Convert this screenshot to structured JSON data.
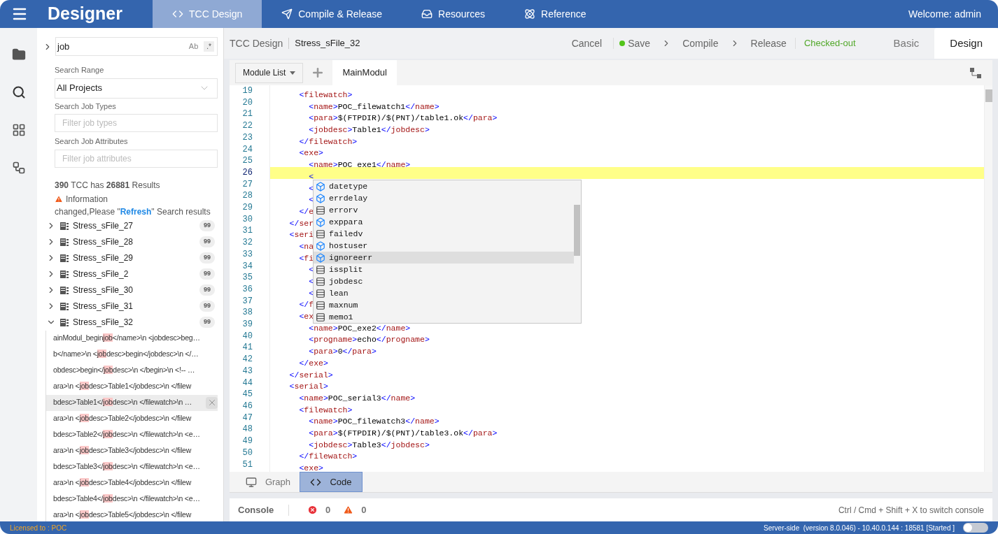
{
  "app": {
    "title": "Designer",
    "welcome": "Welcome: admin"
  },
  "nav_tabs": [
    {
      "label": "TCC Design",
      "selected": true
    },
    {
      "label": "Compile & Release",
      "selected": false
    },
    {
      "label": "Resources",
      "selected": false
    },
    {
      "label": "Reference",
      "selected": false
    }
  ],
  "sidebar": {
    "search": {
      "value": "job",
      "case_toggle": "Ab",
      "regex_toggle": ".*"
    },
    "range": {
      "label": "Search Range",
      "value": "All Projects"
    },
    "job_types": {
      "label": "Search Job Types",
      "placeholder": "Filter job types"
    },
    "job_attributes": {
      "label": "Search Job Attributes",
      "placeholder": "Filter job attributes"
    },
    "summary": "**390** TCC has **26881** Results",
    "notice": {
      "title": "Information",
      "before": "changed,Please \"",
      "link": "Refresh",
      "after": "\" Search results"
    },
    "results": [
      {
        "name": "Stress_sFile_27",
        "count": "99",
        "expanded": false
      },
      {
        "name": "Stress_sFile_28",
        "count": "99",
        "expanded": false
      },
      {
        "name": "Stress_sFile_29",
        "count": "99",
        "expanded": false
      },
      {
        "name": "Stress_sFile_2",
        "count": "99",
        "expanded": false
      },
      {
        "name": "Stress_sFile_30",
        "count": "99",
        "expanded": false
      },
      {
        "name": "Stress_sFile_31",
        "count": "99",
        "expanded": false
      },
      {
        "name": "Stress_sFile_32",
        "count": "99",
        "expanded": true,
        "children": [
          {
            "before": "ainModul_begin",
            "match": "job",
            "after": "</name>\\n <jobdesc>beg…",
            "selected": false
          },
          {
            "before": "b</name>\\n <",
            "match": "job",
            "after": "desc>begin</jobdesc>\\n </…",
            "selected": false
          },
          {
            "before": "obdesc>begin</",
            "match": "job",
            "after": "desc>\\n </begin>\\n <!-- …",
            "selected": false
          },
          {
            "before": "ara>\\n <",
            "match": "job",
            "after": "desc>Table1</jobdesc>\\n </filew",
            "selected": false
          },
          {
            "before": "bdesc>Table1</",
            "match": "job",
            "after": "desc>\\n </filewatch>\\n …",
            "selected": true
          },
          {
            "before": "ara>\\n <",
            "match": "job",
            "after": "desc>Table2</jobdesc>\\n </filew",
            "selected": false
          },
          {
            "before": "bdesc>Table2</",
            "match": "job",
            "after": "desc>\\n </filewatch>\\n <e…",
            "selected": false
          },
          {
            "before": "ara>\\n <",
            "match": "job",
            "after": "desc>Table3</jobdesc>\\n </filew",
            "selected": false
          },
          {
            "before": "bdesc>Table3</",
            "match": "job",
            "after": "desc>\\n </filewatch>\\n <e…",
            "selected": false
          },
          {
            "before": "ara>\\n <",
            "match": "job",
            "after": "desc>Table4</jobdesc>\\n </filew",
            "selected": false
          },
          {
            "before": "bdesc>Table4</",
            "match": "job",
            "after": "desc>\\n </filewatch>\\n <e…",
            "selected": false
          },
          {
            "before": "ara>\\n <",
            "match": "job",
            "after": "desc>Table5</jobdesc>\\n </filew",
            "selected": false
          }
        ]
      }
    ]
  },
  "header": {
    "section": "TCC Design",
    "file": "Stress_sFile_32",
    "cancel": "Cancel",
    "save": "Save",
    "compile": "Compile",
    "release": "Release",
    "status": "Checked-out",
    "view_tabs": [
      {
        "label": "Basic",
        "selected": false
      },
      {
        "label": "Design",
        "selected": true
      }
    ]
  },
  "toolbar": {
    "module_list": "Module List",
    "modules": [
      {
        "label": "MainModul",
        "selected": true
      }
    ]
  },
  "editor": {
    "lines": [
      {
        "number": "19",
        "code": "      <filewatch>",
        "current": false
      },
      {
        "number": "20",
        "code": "        <name>POC_filewatch1</name>",
        "current": false
      },
      {
        "number": "21",
        "code": "        <para>$(FTPDIR)/$(PNT)/table1.ok</para>",
        "current": false
      },
      {
        "number": "22",
        "code": "        <jobdesc>Table1</jobdesc>",
        "current": false
      },
      {
        "number": "23",
        "code": "      </filewatch>",
        "current": false
      },
      {
        "number": "24",
        "code": "      <exe>",
        "current": false
      },
      {
        "number": "25",
        "code": "        <name>POC_exe1</name>",
        "current": false
      },
      {
        "number": "26",
        "code": "        <",
        "current": true
      },
      {
        "number": "27",
        "code": "        <",
        "current": false
      },
      {
        "number": "28",
        "code": "        <",
        "current": false
      },
      {
        "number": "29",
        "code": "      </e",
        "current": false
      },
      {
        "number": "30",
        "code": "    </ser",
        "current": false
      },
      {
        "number": "31",
        "code": "    <seri",
        "current": false
      },
      {
        "number": "32",
        "code": "      <na",
        "current": false
      },
      {
        "number": "33",
        "code": "      <fi",
        "current": false
      },
      {
        "number": "34",
        "code": "        <",
        "current": false
      },
      {
        "number": "35",
        "code": "        <",
        "current": false
      },
      {
        "number": "36",
        "code": "        <",
        "current": false
      },
      {
        "number": "37",
        "code": "      </f",
        "current": false
      },
      {
        "number": "38",
        "code": "      <ex",
        "current": false
      },
      {
        "number": "39",
        "code": "        <name>POC_exe2</name>",
        "current": false
      },
      {
        "number": "40",
        "code": "        <progname>echo</progname>",
        "current": false
      },
      {
        "number": "41",
        "code": "        <para>0</para>",
        "current": false
      },
      {
        "number": "42",
        "code": "      </exe>",
        "current": false
      },
      {
        "number": "43",
        "code": "    </serial>",
        "current": false
      },
      {
        "number": "44",
        "code": "    <serial>",
        "current": false
      },
      {
        "number": "45",
        "code": "      <name>POC_serial3</name>",
        "current": false
      },
      {
        "number": "46",
        "code": "      <filewatch>",
        "current": false
      },
      {
        "number": "47",
        "code": "        <name>POC_filewatch3</name>",
        "current": false
      },
      {
        "number": "48",
        "code": "        <para>$(FTPDIR)/$(PNT)/table3.ok</para>",
        "current": false
      },
      {
        "number": "49",
        "code": "        <jobdesc>Table3</jobdesc>",
        "current": false
      },
      {
        "number": "50",
        "code": "      </filewatch>",
        "current": false
      },
      {
        "number": "51",
        "code": "      <exe>",
        "current": false
      }
    ],
    "suggestions": [
      {
        "label": "datetype",
        "kind": "property",
        "selected": false
      },
      {
        "label": "errdelay",
        "kind": "property",
        "selected": false
      },
      {
        "label": "errorv",
        "kind": "field",
        "selected": false
      },
      {
        "label": "exppara",
        "kind": "property",
        "selected": false
      },
      {
        "label": "failedv",
        "kind": "field",
        "selected": false
      },
      {
        "label": "hostuser",
        "kind": "property",
        "selected": false
      },
      {
        "label": "ignoreerr",
        "kind": "property",
        "selected": true
      },
      {
        "label": "issplit",
        "kind": "field",
        "selected": false
      },
      {
        "label": "jobdesc",
        "kind": "field",
        "selected": false
      },
      {
        "label": "lean",
        "kind": "field",
        "selected": false
      },
      {
        "label": "maxnum",
        "kind": "field",
        "selected": false
      },
      {
        "label": "memo1",
        "kind": "field",
        "selected": false
      }
    ]
  },
  "view_switch": [
    {
      "label": "Graph",
      "selected": false
    },
    {
      "label": "Code",
      "selected": true
    }
  ],
  "console": {
    "title": "Console",
    "errors": "0",
    "warnings": "0",
    "hint": "Ctrl / Cmd + Shift + X to switch console"
  },
  "footer": {
    "license": "Licensed to : POC",
    "server": "Server-side  (version 8.0.046) - 10.40.0.144 : 18581 [Started ]",
    "server_on": false
  }
}
